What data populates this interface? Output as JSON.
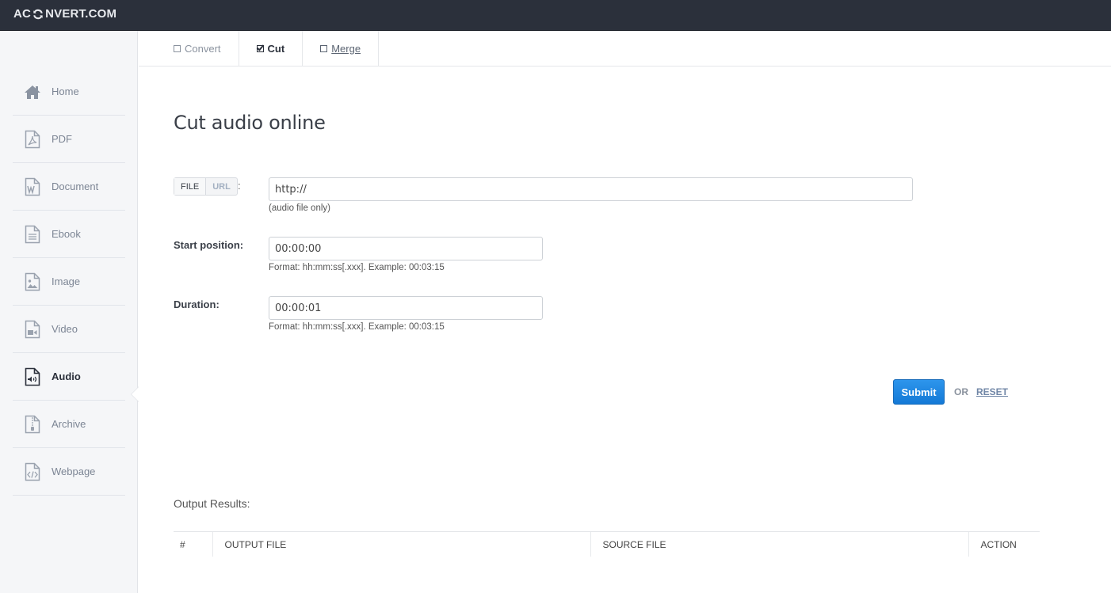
{
  "header": {
    "logo_prefix": "AC",
    "logo_suffix": "NVERT.COM"
  },
  "sidebar": {
    "items": [
      {
        "label": "Home",
        "icon": "home-icon"
      },
      {
        "label": "PDF",
        "icon": "pdf-file-icon"
      },
      {
        "label": "Document",
        "icon": "word-file-icon"
      },
      {
        "label": "Ebook",
        "icon": "ebook-file-icon"
      },
      {
        "label": "Image",
        "icon": "image-file-icon"
      },
      {
        "label": "Video",
        "icon": "video-file-icon"
      },
      {
        "label": "Audio",
        "icon": "audio-file-icon",
        "active": true
      },
      {
        "label": "Archive",
        "icon": "archive-file-icon"
      },
      {
        "label": "Webpage",
        "icon": "webpage-file-icon"
      }
    ]
  },
  "tabs": [
    {
      "label": "Convert",
      "checked": false
    },
    {
      "label": "Cut",
      "checked": true
    },
    {
      "label": "Merge",
      "checked": false
    }
  ],
  "main": {
    "title": "Cut audio online",
    "source_toggle": {
      "file": "FILE",
      "url": "URL",
      "colon": ":"
    },
    "url_input": {
      "value": "http://",
      "hint": "(audio file only)"
    },
    "start_position": {
      "label": "Start position:",
      "value": "00:00:00",
      "hint": "Format: hh:mm:ss[.xxx]. Example: 00:03:15"
    },
    "duration": {
      "label": "Duration:",
      "value": "00:00:01",
      "hint": "Format: hh:mm:ss[.xxx]. Example: 00:03:15"
    },
    "submit_label": "Submit",
    "or_label": "OR",
    "reset_label": "RESET"
  },
  "results": {
    "title": "Output Results:",
    "columns": [
      "#",
      "OUTPUT FILE",
      "SOURCE FILE",
      "ACTION"
    ]
  },
  "colors": {
    "topbar": "#2b303b",
    "accent": "#1e88e5",
    "sidebar_bg": "#f5f6f8"
  }
}
